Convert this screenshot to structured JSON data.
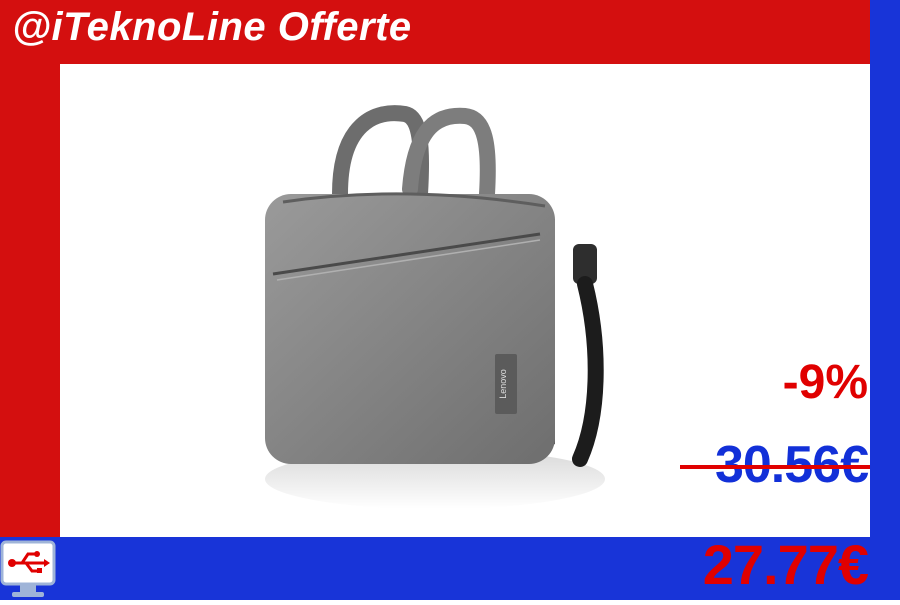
{
  "header": {
    "brand": "@iTeknoLine Offerte"
  },
  "product": {
    "image_description_icon": "laptop-bag-icon",
    "brand_tag": "Lenovo"
  },
  "pricing": {
    "discount": "-9%",
    "original_price": "30.56€",
    "sale_price": "27.77€"
  },
  "colors": {
    "red": "#d40f0f",
    "blue": "#1834d8",
    "price_red": "#e00000",
    "price_blue": "#1230d8"
  },
  "logo": {
    "icon": "computer-usb-logo-icon"
  }
}
